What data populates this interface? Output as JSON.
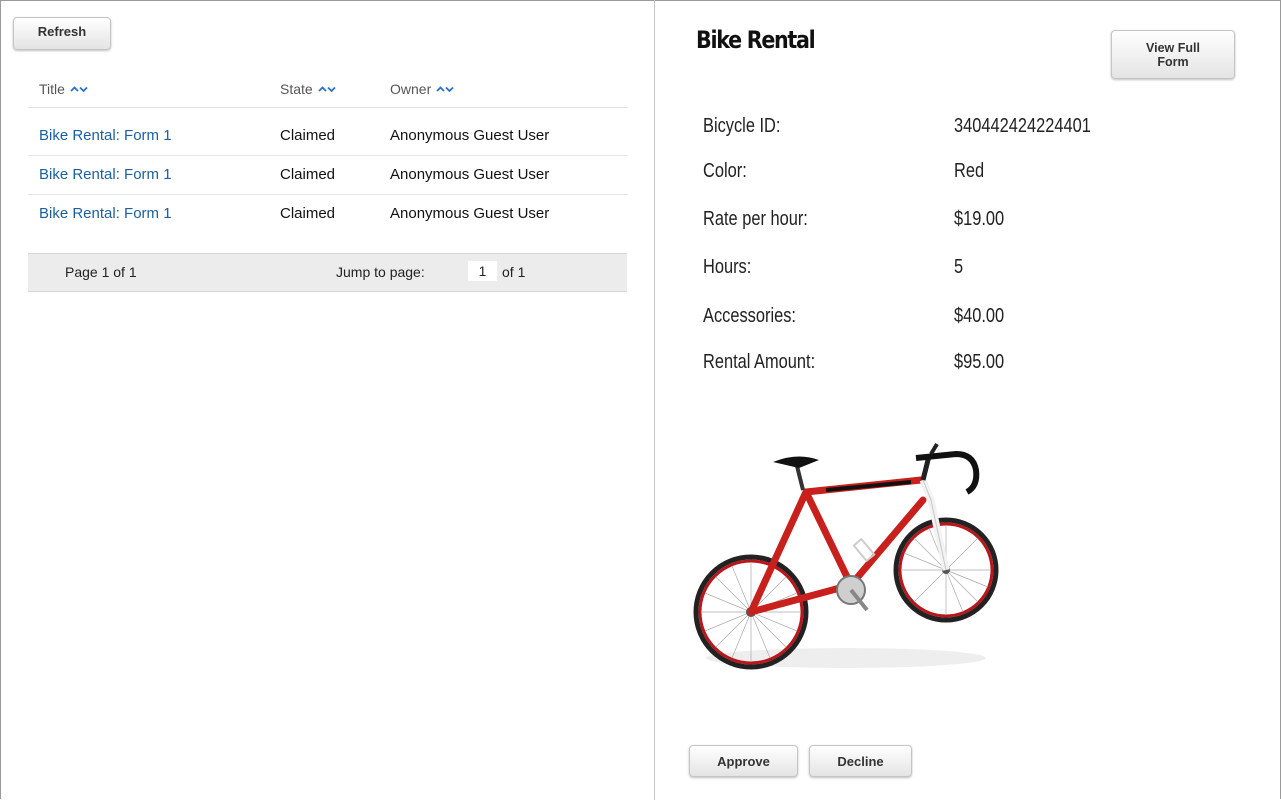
{
  "toolbar": {
    "refresh_label": "Refresh"
  },
  "table": {
    "columns": {
      "title": "Title",
      "state": "State",
      "owner": "Owner"
    },
    "rows": [
      {
        "title": "Bike Rental: Form 1",
        "state": "Claimed",
        "owner": "Anonymous Guest User"
      },
      {
        "title": "Bike Rental: Form 1",
        "state": "Claimed",
        "owner": "Anonymous Guest User"
      },
      {
        "title": "Bike Rental: Form 1",
        "state": "Claimed",
        "owner": "Anonymous Guest User"
      }
    ],
    "pager": {
      "page_text": "Page 1 of 1",
      "jump_label": "Jump to page:",
      "current_page": "1",
      "of_text": "of 1"
    }
  },
  "form": {
    "title": "Bike Rental",
    "view_full_line1": "View Full",
    "view_full_line2": "Form",
    "fields": [
      {
        "label": "Bicycle ID:",
        "value": "340442424224401"
      },
      {
        "label": "Color:",
        "value": "Red"
      },
      {
        "label": "Rate per hour:",
        "value": "$19.00"
      },
      {
        "label": "Hours:",
        "value": "5"
      },
      {
        "label": "Accessories:",
        "value": "$40.00"
      },
      {
        "label": "Rental Amount:",
        "value": "$95.00"
      }
    ],
    "image_name": "bicycle-image",
    "approve_label": "Approve",
    "decline_label": "Decline"
  },
  "colors": {
    "link": "#1c5f9e",
    "sort_arrow": "#2a6fc9",
    "bike_frame": "#c8201c",
    "pager_bg": "#ececec"
  }
}
